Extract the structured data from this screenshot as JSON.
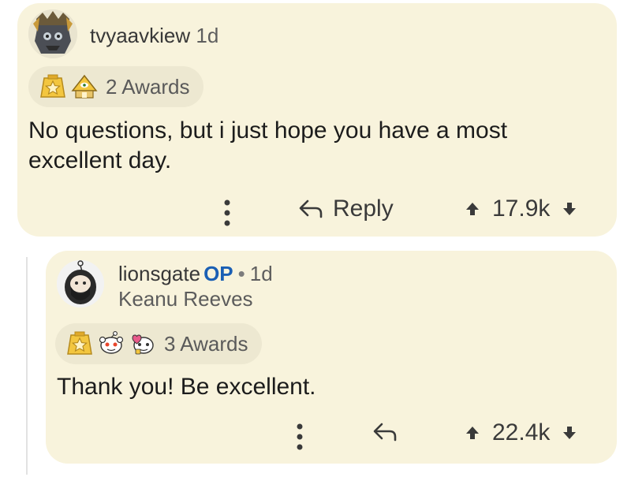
{
  "comments": [
    {
      "username": "tvyaavkiew",
      "age": "1d",
      "awards_label": "2 Awards",
      "award_icons": [
        "star-award-icon",
        "eye-pyramid-award-icon"
      ],
      "body": "No questions, but i just hope you have a most excellent day.",
      "reply_label": "Reply",
      "score": "17.9k"
    },
    {
      "username": "lionsgate",
      "op_badge": "OP",
      "separator": "•",
      "age": "1d",
      "flair": "Keanu Reeves",
      "awards_label": "3 Awards",
      "award_icons": [
        "star-award-icon",
        "snoo-face-award-icon",
        "snoo-heart-award-icon"
      ],
      "body": "Thank you! Be excellent.",
      "score": "22.4k"
    }
  ],
  "colors": {
    "card_bg": "#f8f3dc",
    "pill_bg": "#ede8d1",
    "op_blue": "#1a5fb4",
    "award_gold": "#f3c63f"
  }
}
